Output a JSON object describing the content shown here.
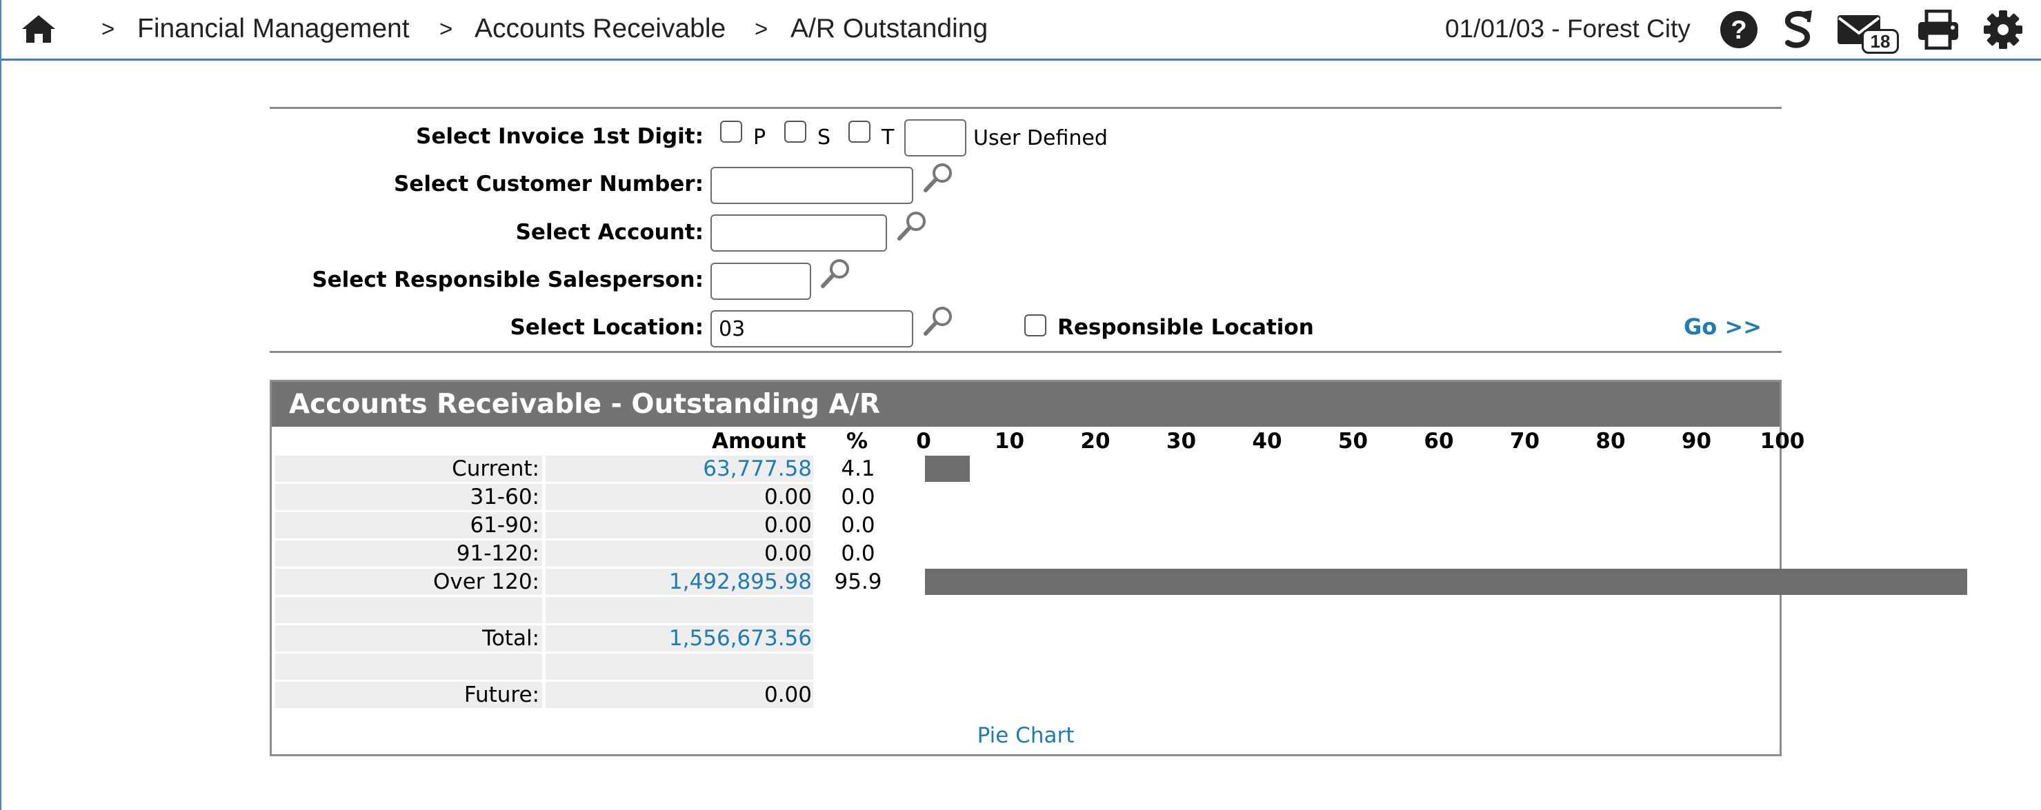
{
  "breadcrumb": [
    "Financial Management",
    "Accounts Receivable",
    "A/R Outstanding"
  ],
  "breadcrumb_separator": ">",
  "context": "01/01/03 - Forest City",
  "mail_count": "18",
  "icons": {
    "home": "home-icon",
    "help": "help-icon",
    "sync": "s-logo-icon",
    "mail": "mail-icon",
    "print": "print-icon",
    "settings": "gear-icon",
    "lookup": "magnifier-icon"
  },
  "colors": {
    "accent": "#1d7bb5",
    "bar": "#6e6e6e",
    "header": "#737373",
    "topline": "#3d7fc1"
  },
  "filters": {
    "invoice_digit_label": "Select Invoice 1st Digit:",
    "digit_p": "P",
    "digit_s": "S",
    "digit_t": "T",
    "user_defined_label": "User Defined",
    "user_defined_value": "",
    "customer_label": "Select Customer Number:",
    "customer_value": "",
    "account_label": "Select Account:",
    "account_value": "",
    "salesperson_label": "Select Responsible Salesperson:",
    "salesperson_value": "",
    "location_label": "Select Location:",
    "location_value": "03",
    "responsible_location_label": "Responsible Location",
    "go_label": "Go >>"
  },
  "panel": {
    "title": "Accounts Receivable - Outstanding A/R",
    "amount_header": "Amount",
    "pct_header": "%",
    "pie_chart_link": "Pie Chart"
  },
  "chart_data": {
    "type": "bar",
    "orientation": "horizontal",
    "categories": [
      "Current:",
      "31-60:",
      "61-90:",
      "91-120:",
      "Over 120:"
    ],
    "amounts": [
      "63,777.58",
      "0.00",
      "0.00",
      "0.00",
      "1,492,895.98"
    ],
    "amount_links": [
      true,
      false,
      false,
      false,
      true
    ],
    "values": [
      4.1,
      0.0,
      0.0,
      0.0,
      95.9
    ],
    "values_text": [
      "4.1",
      "0.0",
      "0.0",
      "0.0",
      "95.9"
    ],
    "xlim": [
      0,
      100
    ],
    "ticks": [
      "0",
      "10",
      "20",
      "30",
      "40",
      "50",
      "60",
      "70",
      "80",
      "90",
      "100"
    ],
    "total_label": "Total:",
    "total_amount": "1,556,673.56",
    "future_label": "Future:",
    "future_amount": "0.00"
  }
}
